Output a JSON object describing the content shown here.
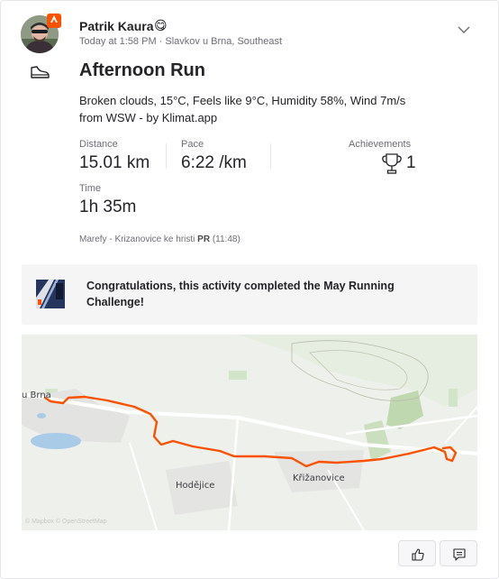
{
  "athlete": {
    "name": "Patrik Kaura",
    "emoji": "😋",
    "meta": "Today at 1:58 PM · Slavkov u Brna, Southeast"
  },
  "activity": {
    "type_icon": "shoe-icon",
    "title": "Afternoon Run",
    "description": "Broken clouds, 15°C, Feels like 9°C, Humidity 58%, Wind 7m/s from WSW - by Klimat.app"
  },
  "stats": {
    "distance_label": "Distance",
    "distance_value": "15.01 km",
    "pace_label": "Pace",
    "pace_value": "6:22 /km",
    "achievements_label": "Achievements",
    "achievements_value": "1",
    "time_label": "Time",
    "time_value": "1h 35m"
  },
  "segment": {
    "name": "Marefy - Krizanovice ke hristi",
    "badge": "PR",
    "time": "(11:48)"
  },
  "challenge": {
    "text": "Congratulations, this activity completed the May Running Challenge!"
  },
  "map": {
    "labels": {
      "town_left": "u Brna",
      "town_mid": "Hodějice",
      "town_right": "Křižanovice"
    },
    "attribution": "© Mapbox © OpenStreetMap"
  },
  "colors": {
    "route": "#fc5200",
    "brand": "#fc5200"
  },
  "actions": {
    "kudos_icon": "thumbs-up-icon",
    "comment_icon": "comment-icon"
  }
}
